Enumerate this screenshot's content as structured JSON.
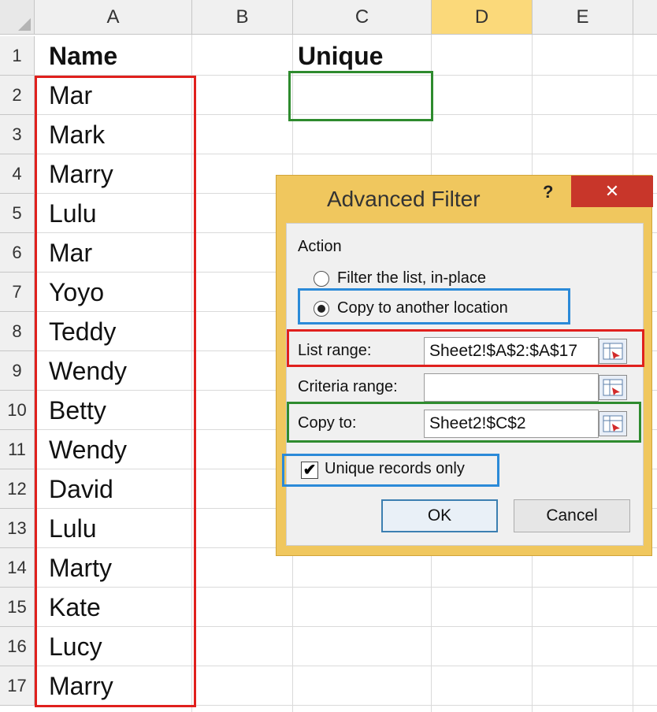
{
  "columns": [
    "A",
    "B",
    "C",
    "D",
    "E"
  ],
  "active_column": "D",
  "rows": [
    "1",
    "2",
    "3",
    "4",
    "5",
    "6",
    "7",
    "8",
    "9",
    "10",
    "11",
    "12",
    "13",
    "14",
    "15",
    "16",
    "17"
  ],
  "cells": {
    "a1": "Name",
    "c1": "Unique",
    "names": [
      "Mar",
      "Mark",
      "Marry",
      "Lulu",
      "Mar",
      "Yoyo",
      "Teddy",
      "Wendy",
      "Betty",
      "Wendy",
      "David",
      "Lulu",
      "Marty",
      "Kate",
      "Lucy",
      "Marry"
    ]
  },
  "dialog": {
    "title": "Advanced Filter",
    "help_icon": "?",
    "close_icon": "✕",
    "action_label": "Action",
    "radio_inplace": "Filter the list, in-place",
    "radio_copy": "Copy to another location",
    "selected_action": "copy",
    "list_range_label": "List range:",
    "list_range_value": "Sheet2!$A$2:$A$17",
    "criteria_range_label": "Criteria range:",
    "criteria_range_value": "",
    "copy_to_label": "Copy to:",
    "copy_to_value": "Sheet2!$C$2",
    "unique_label": "Unique records only",
    "unique_checked": true,
    "ok_label": "OK",
    "cancel_label": "Cancel"
  },
  "colors": {
    "highlight_red": "#e0201d",
    "highlight_green": "#2e8b2e",
    "highlight_blue": "#2b8ad8",
    "dialog_frame": "#f0c75e",
    "close_button": "#c8362a",
    "active_header": "#fbd97a"
  }
}
